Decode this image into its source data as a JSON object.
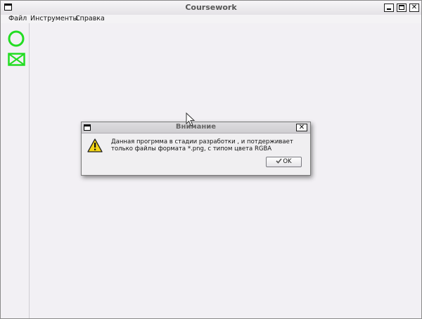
{
  "window": {
    "title": "Coursework",
    "controls": {
      "minimize": "",
      "maximize": "",
      "close": "✕"
    }
  },
  "menubar": {
    "items": [
      {
        "label": "Файл"
      },
      {
        "label": "Инструменты"
      },
      {
        "label": "Справка"
      }
    ]
  },
  "tools": [
    {
      "icon": "circle-tool-icon",
      "color": "#22dd22"
    },
    {
      "icon": "envelope-tool-icon",
      "color": "#22dd22"
    }
  ],
  "dialog": {
    "title": "Внимание",
    "close": "✕",
    "icon": "warning-icon",
    "message": "Данная прогрмма в стадии разработки , и потдерживает только файлы формата *.png, с типом цвета RGBA",
    "ok_label": "OK"
  }
}
